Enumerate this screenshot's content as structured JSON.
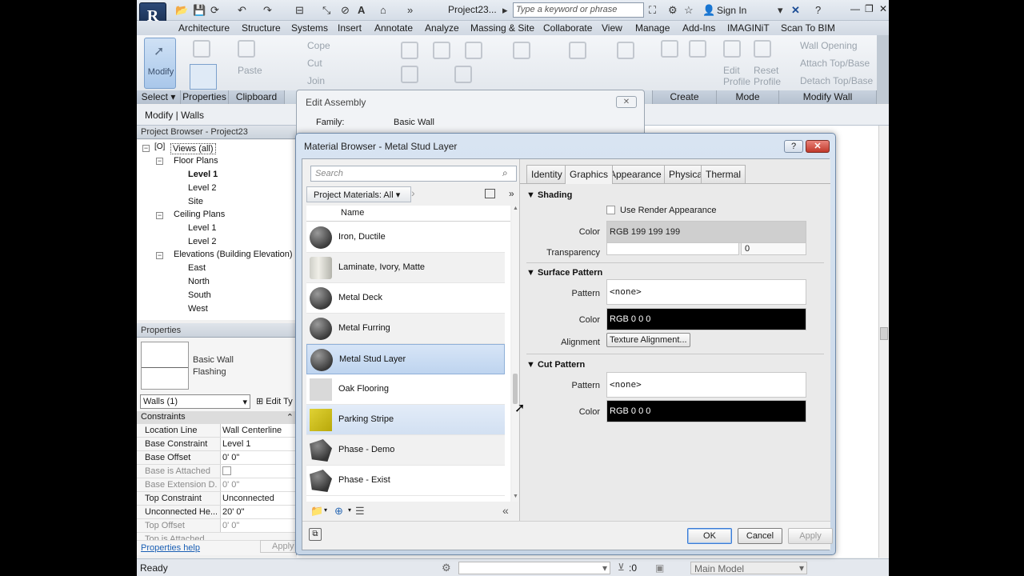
{
  "app": {
    "title": "Project23...",
    "search_placeholder": "Type a keyword or phrase",
    "sign_in": "Sign In"
  },
  "ribbon_tabs": [
    "Architecture",
    "Structure",
    "Systems",
    "Insert",
    "Annotate",
    "Analyze",
    "Massing & Site",
    "Collaborate",
    "View",
    "Manage",
    "Add-Ins",
    "IMAGINiT",
    "Scan To BIM"
  ],
  "ribbon": {
    "modify": "Modify",
    "paste": "Paste",
    "cope": "Cope",
    "cut": "Cut",
    "join": "Join",
    "edit_profile": "Edit Profile",
    "reset_profile": "Reset Profile",
    "wall_opening": "Wall Opening",
    "attach": "Attach Top/Base",
    "detach": "Detach Top/Base",
    "panels": [
      "Select",
      "Properties",
      "Clipboard",
      "Create",
      "Mode",
      "Modify Wall"
    ]
  },
  "modify_bar": "Modify | Walls",
  "project_browser": {
    "title": "Project Browser - Project23",
    "root": "Views (all)",
    "floor_plans": "Floor Plans",
    "fp_items": [
      "Level 1",
      "Level 2",
      "Site"
    ],
    "ceiling_plans": "Ceiling Plans",
    "cp_items": [
      "Level 1",
      "Level 2"
    ],
    "elevations": "Elevations (Building Elevation)",
    "el_items": [
      "East",
      "North",
      "South",
      "West"
    ]
  },
  "properties": {
    "title": "Properties",
    "type_name": "Basic Wall",
    "type_sub": "Flashing",
    "selector": "Walls (1)",
    "edit_type": "Edit Ty",
    "category": "Constraints",
    "rows": [
      {
        "label": "Location Line",
        "value": "Wall Centerline"
      },
      {
        "label": "Base Constraint",
        "value": "Level 1"
      },
      {
        "label": "Base Offset",
        "value": "0'  0\""
      },
      {
        "label": "Base is Attached",
        "value": ""
      },
      {
        "label": "Base Extension D...",
        "value": "0'  0\""
      },
      {
        "label": "Top Constraint",
        "value": "Unconnected"
      },
      {
        "label": "Unconnected He...",
        "value": "20'  0\""
      },
      {
        "label": "Top Offset",
        "value": "0'  0\""
      },
      {
        "label": "Top is Attached",
        "value": ""
      }
    ],
    "help": "Properties help",
    "apply": "Apply"
  },
  "edit_assembly": {
    "title": "Edit Assembly",
    "family_label": "Family:",
    "family_value": "Basic Wall"
  },
  "material_browser": {
    "title": "Material Browser - Metal Stud Layer",
    "search_placeholder": "Search",
    "filter": "Project Materials: All",
    "column": "Name",
    "materials": [
      {
        "name": "Iron, Ductile",
        "swatch": "sphere"
      },
      {
        "name": "Laminate, Ivory, Matte",
        "swatch": "cube-lam"
      },
      {
        "name": "Metal Deck",
        "swatch": "sphere"
      },
      {
        "name": "Metal Furring",
        "swatch": "sphere"
      },
      {
        "name": "Metal Stud Layer",
        "swatch": "sphere",
        "selected": true
      },
      {
        "name": "Oak Flooring",
        "swatch": "flat"
      },
      {
        "name": "Parking Stripe",
        "swatch": "yel"
      },
      {
        "name": "Phase - Demo",
        "swatch": "phase"
      },
      {
        "name": "Phase - Exist",
        "swatch": "phase"
      }
    ],
    "tabs": [
      "Identity",
      "Graphics",
      "Appearance",
      "Physical",
      "Thermal"
    ],
    "active_tab": "Graphics",
    "shading": {
      "title": "Shading",
      "use_render": "Use Render Appearance",
      "color_label": "Color",
      "color_value": "RGB 199 199 199",
      "transparency_label": "Transparency",
      "transparency_value": "0"
    },
    "surface_pattern": {
      "title": "Surface Pattern",
      "pattern_label": "Pattern",
      "pattern_value": "<none>",
      "color_label": "Color",
      "color_value": "RGB 0 0 0",
      "alignment_label": "Alignment",
      "alignment_button": "Texture Alignment..."
    },
    "cut_pattern": {
      "title": "Cut Pattern",
      "pattern_label": "Pattern",
      "pattern_value": "<none>",
      "color_label": "Color",
      "color_value": "RGB 0 0 0"
    },
    "buttons": {
      "ok": "OK",
      "cancel": "Cancel",
      "apply": "Apply"
    }
  },
  "status": {
    "text": "Ready",
    "coord": ":0",
    "model": "Main Model"
  }
}
